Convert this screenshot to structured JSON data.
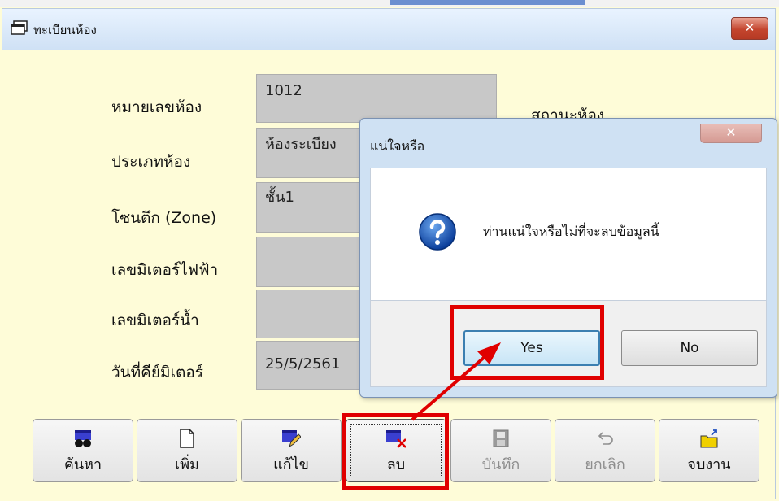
{
  "window": {
    "title": "ทะเบียนห้อง",
    "close_label": "✕"
  },
  "form": {
    "room_number": {
      "label": "หมายเลขห้อง",
      "value": "1012"
    },
    "room_type": {
      "label": "ประเภทห้อง",
      "value": "ห้องระเบียง"
    },
    "zone": {
      "label": "โซนตึก (Zone)",
      "value": "ชั้น1"
    },
    "electric_meter": {
      "label": "เลขมิเตอร์ไฟฟ้า",
      "value": ""
    },
    "water_meter": {
      "label": "เลขมิเตอร์น้ำ",
      "value": ""
    },
    "meter_date": {
      "label": "วันที่คีย์มิเตอร์",
      "value": "25/5/2561"
    },
    "room_status_label": "สถานะห้อง"
  },
  "toolbar": {
    "search": "ค้นหา",
    "add": "เพิ่ม",
    "edit": "แก้ไข",
    "delete": "ลบ",
    "save": "บันทึก",
    "cancel": "ยกเลิก",
    "exit": "จบงาน"
  },
  "dialog": {
    "title": "แน่ใจหรือ",
    "close_label": "✕",
    "message": "ท่านแน่ใจหรือไม่ที่จะลบข้อมูลนี้",
    "yes_label": "Yes",
    "no_label": "No"
  },
  "colors": {
    "highlight": "#e00000",
    "background": "#fefcd8",
    "field": "#c8c8c8"
  }
}
